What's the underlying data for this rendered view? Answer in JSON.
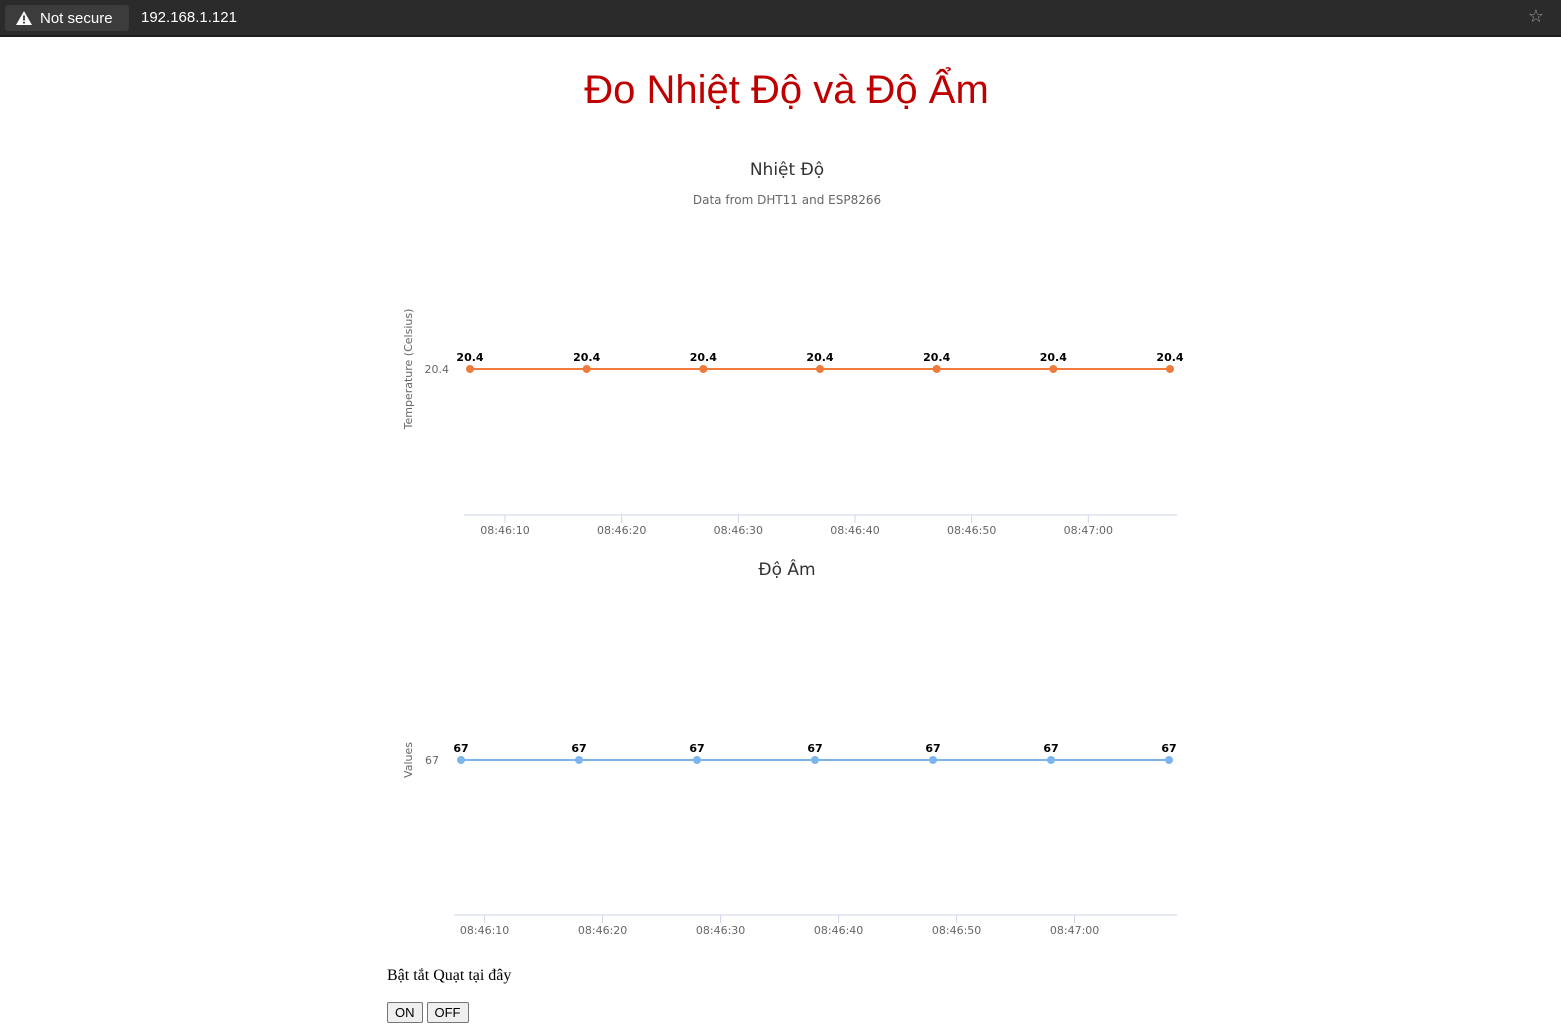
{
  "browser": {
    "security_label": "Not secure",
    "url": "192.168.1.121",
    "icons": {
      "security": "warning-triangle-icon",
      "bookmark": "star-icon"
    }
  },
  "page": {
    "heading": "Đo Nhiệt Độ và Độ Ẩm",
    "heading_color": "#bf0000"
  },
  "controls": {
    "label": "Bật tắt Quạt tại đây",
    "on_label": "ON",
    "off_label": "OFF"
  },
  "chart_data": [
    {
      "type": "line",
      "title": "Nhiệt Độ",
      "subtitle": "Data from DHT11 and ESP8266",
      "ylabel": "Temperature (Celsius)",
      "xlabel": "",
      "x": [
        "08:46:07",
        "08:46:17",
        "08:46:27",
        "08:46:37",
        "08:46:47",
        "08:46:57",
        "08:47:07"
      ],
      "x_ticks": [
        "08:46:10",
        "08:46:20",
        "08:46:30",
        "08:46:40",
        "08:46:50",
        "08:47:00"
      ],
      "y_ticks": [
        "20.4"
      ],
      "series": [
        {
          "values": [
            20.4,
            20.4,
            20.4,
            20.4,
            20.4,
            20.4,
            20.4
          ]
        }
      ],
      "color": "#f07a3c",
      "data_labels": true,
      "grid": false,
      "legend": "none"
    },
    {
      "type": "line",
      "title": "Độ Âm",
      "subtitle": "",
      "ylabel": "Values",
      "xlabel": "",
      "x": [
        "08:46:08",
        "08:46:18",
        "08:46:28",
        "08:46:38",
        "08:46:48",
        "08:46:58",
        "08:47:08"
      ],
      "x_ticks": [
        "08:46:10",
        "08:46:20",
        "08:46:30",
        "08:46:40",
        "08:46:50",
        "08:47:00"
      ],
      "y_ticks": [
        "67"
      ],
      "series": [
        {
          "values": [
            67,
            67,
            67,
            67,
            67,
            67,
            67
          ]
        }
      ],
      "color": "#7cb5ec",
      "data_labels": true,
      "grid": false,
      "legend": "none"
    }
  ]
}
